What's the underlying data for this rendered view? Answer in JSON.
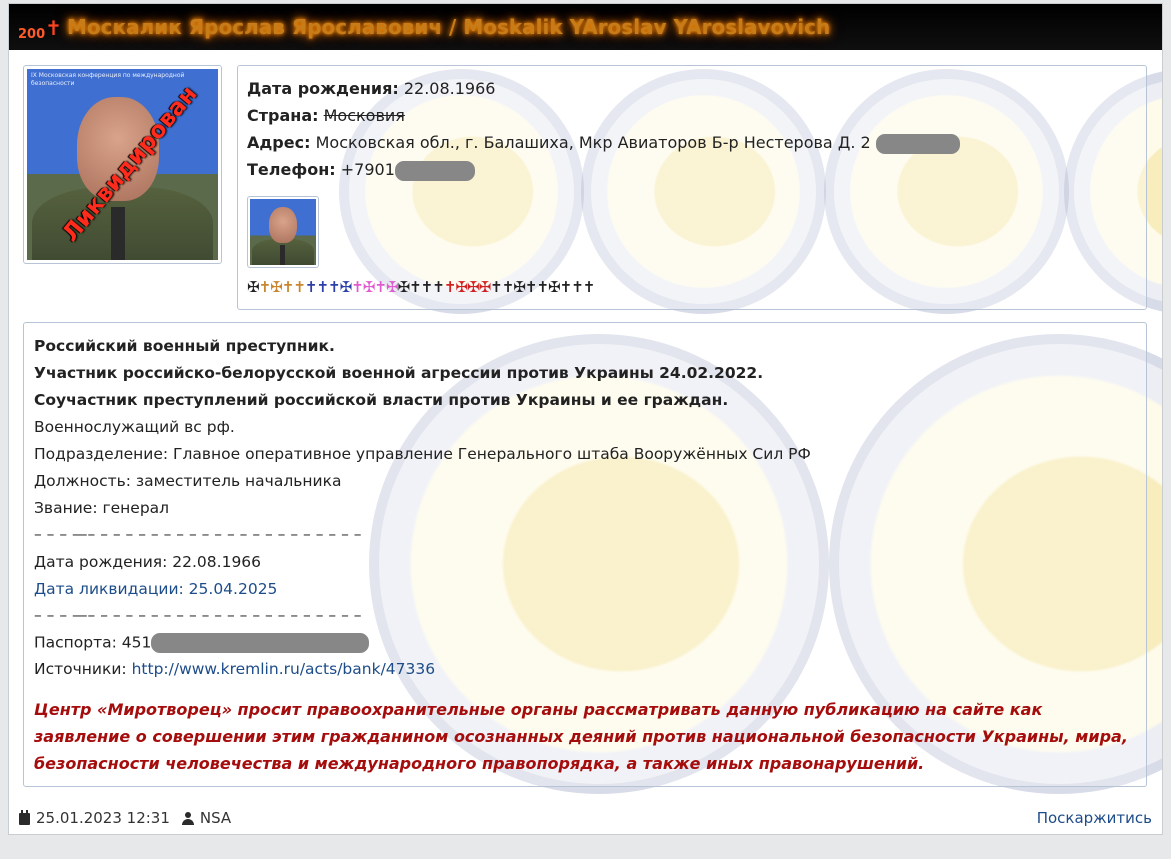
{
  "header": {
    "mark_number": "200",
    "mark_cross": "✝",
    "title": "Москалик Ярослав Ярославович / Moskalik YAroslav YAroslavovich"
  },
  "photo": {
    "stamp": "Ликвидирован",
    "banner": "IX Московская конференция по международной безопасности"
  },
  "info": {
    "birth_label": "Дата рождения:",
    "birth_value": "22.08.1966",
    "country_label": "Страна:",
    "country_value": "Московия",
    "address_label": "Адрес:",
    "address_value": "Московская обл., г. Балашиха, Мкр Авиаторов Б-р Нестерова Д. 2",
    "phone_label": "Телефон:",
    "phone_value": "+7901",
    "crosses": [
      {
        "glyph": "✠",
        "color": "#222222"
      },
      {
        "glyph": "✝",
        "color": "#c8862f"
      },
      {
        "glyph": "✠",
        "color": "#c8862f"
      },
      {
        "glyph": "✝",
        "color": "#c8862f"
      },
      {
        "glyph": "✝",
        "color": "#c8862f"
      },
      {
        "glyph": "✝",
        "color": "#2b3fa8"
      },
      {
        "glyph": "✝",
        "color": "#2b3fa8"
      },
      {
        "glyph": "✝",
        "color": "#2b3fa8"
      },
      {
        "glyph": "✠",
        "color": "#2b3fa8"
      },
      {
        "glyph": "✝",
        "color": "#e05bd0"
      },
      {
        "glyph": "✠",
        "color": "#e05bd0"
      },
      {
        "glyph": "✝",
        "color": "#e05bd0"
      },
      {
        "glyph": "✠",
        "color": "#e05bd0"
      },
      {
        "glyph": "✠",
        "color": "#222222"
      },
      {
        "glyph": "✝",
        "color": "#222222"
      },
      {
        "glyph": "✝",
        "color": "#222222"
      },
      {
        "glyph": "✝",
        "color": "#222222"
      },
      {
        "glyph": "✝",
        "color": "#d22020"
      },
      {
        "glyph": "✠",
        "color": "#d22020"
      },
      {
        "glyph": "✠",
        "color": "#d22020"
      },
      {
        "glyph": "✠",
        "color": "#d22020"
      },
      {
        "glyph": "✝",
        "color": "#222222"
      },
      {
        "glyph": "✝",
        "color": "#222222"
      },
      {
        "glyph": "✠",
        "color": "#222222"
      },
      {
        "glyph": "✝",
        "color": "#222222"
      },
      {
        "glyph": "✝",
        "color": "#222222"
      },
      {
        "glyph": "✠",
        "color": "#222222"
      },
      {
        "glyph": "✝",
        "color": "#222222"
      },
      {
        "glyph": "✝",
        "color": "#222222"
      },
      {
        "glyph": "✝",
        "color": "#222222"
      }
    ]
  },
  "bio": {
    "line1": "Российский военный преступник.",
    "line2": "Участник российско-белорусской военной агрессии против Украины 24.02.2022.",
    "line3": "Соучастник преступлений российской власти против Украины и ее граждан.",
    "line4": "Военнослужащий вс рф.",
    "line5": "Подразделение: Главное оперативное управление Генерального штаба Вооружённых Сил РФ",
    "line6": "Должность: заместитель начальника",
    "line7": "Звание: генерал",
    "separator": "– – – —– – – – – – – – – – – – – – – – – – – –  – –",
    "birth": "Дата рождения: 22.08.1966",
    "liquidation": "Дата ликвидации: 25.04.2025",
    "passport_label": "Паспорта: 451",
    "sources_label": "Источники:",
    "sources_link": "http://www.kremlin.ru/acts/bank/47336",
    "warning": "Центр «Миротворец» просит правоохранительные органы рассматривать данную публикацию на сайте как заявление о совершении этим гражданином осознанных деяний против национальной безопасности Украины, мира, безопасности человечества и международного правопорядка, а также иных правонарушений."
  },
  "footer": {
    "date": "25.01.2023 12:31",
    "author": "NSA",
    "complain": "Поскаржитись"
  }
}
